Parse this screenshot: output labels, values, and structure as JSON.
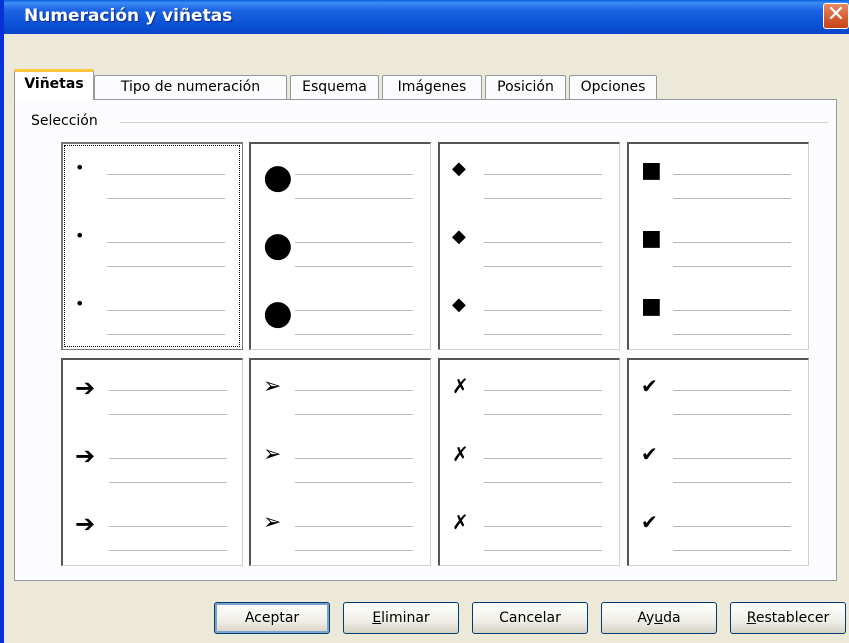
{
  "window": {
    "title": "Numeración y viñetas",
    "close_glyph": "✕"
  },
  "tabs": [
    {
      "label": "Viñetas",
      "active": true
    },
    {
      "label": "Tipo de numeración",
      "active": false
    },
    {
      "label": "Esquema",
      "active": false
    },
    {
      "label": "Imágenes",
      "active": false
    },
    {
      "label": "Posición",
      "active": false
    },
    {
      "label": "Opciones",
      "active": false
    }
  ],
  "selection": {
    "label": "Selección",
    "bullets": [
      {
        "name": "small-dot-bullet",
        "glyph": "•"
      },
      {
        "name": "large-dot-bullet",
        "glyph": "●"
      },
      {
        "name": "diamond-bullet",
        "glyph": "◆"
      },
      {
        "name": "square-bullet",
        "glyph": "■"
      },
      {
        "name": "arrow-bullet",
        "glyph": "➔"
      },
      {
        "name": "arrowhead-bullet",
        "glyph": "➢"
      },
      {
        "name": "cross-bullet",
        "glyph": "✗"
      },
      {
        "name": "checkmark-bullet",
        "glyph": "✔"
      }
    ],
    "selected_index": 0
  },
  "buttons": {
    "accept": "Aceptar",
    "delete_pre": "",
    "delete_key": "E",
    "delete_post": "liminar",
    "cancel": "Cancelar",
    "help_pre": "Ay",
    "help_key": "u",
    "help_post": "da",
    "reset_pre": "",
    "reset_key": "R",
    "reset_post": "establecer"
  }
}
